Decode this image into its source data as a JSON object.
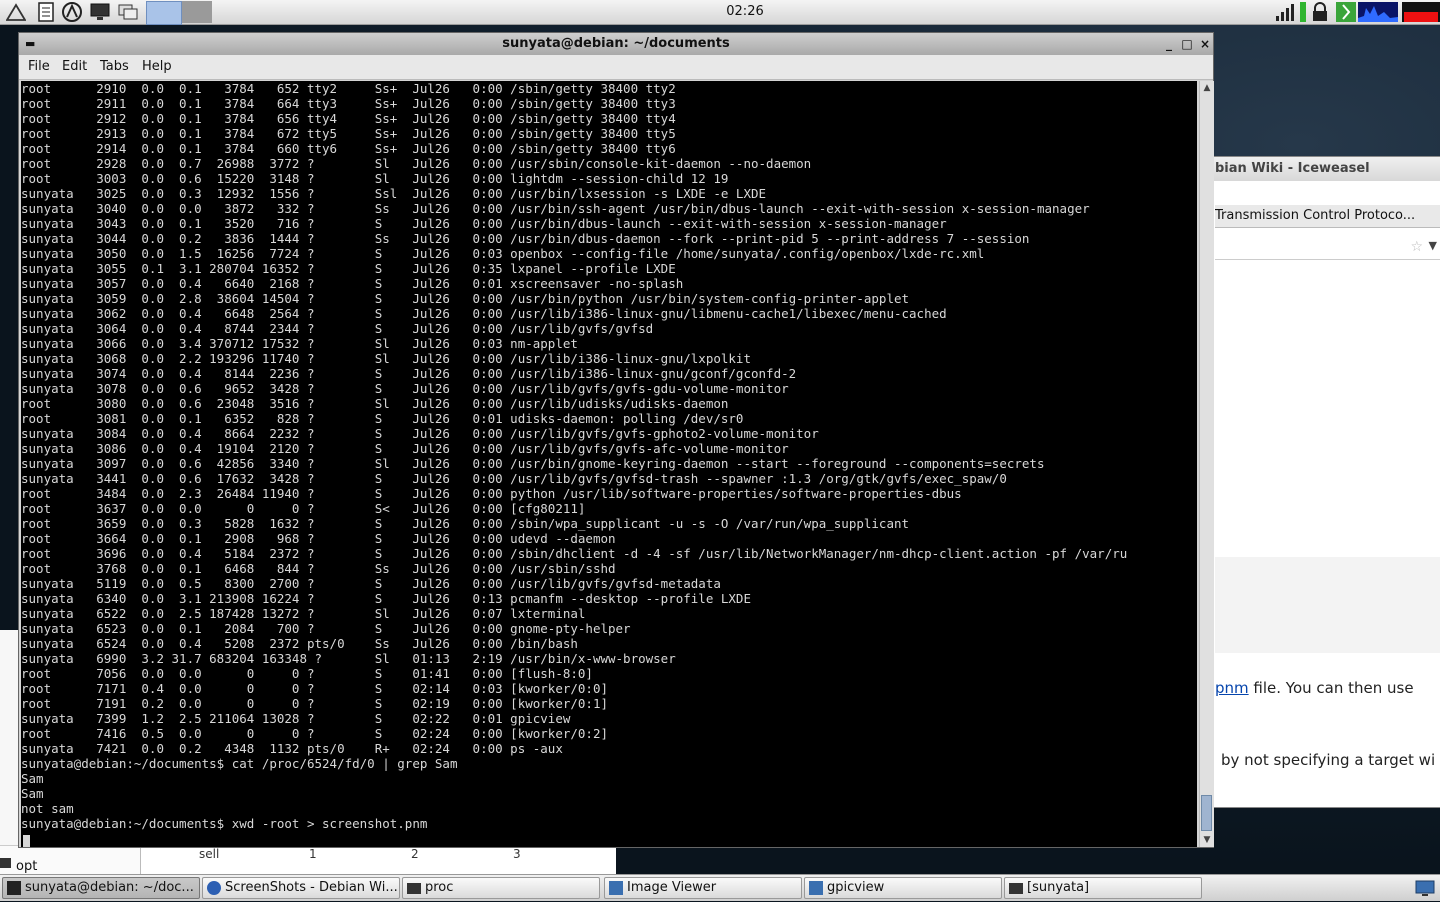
{
  "top_panel": {
    "clock": "02:26",
    "launchers": [
      "menu-icon",
      "notes-icon",
      "browser-icon",
      "monitor-icon",
      "windows-icon"
    ],
    "tray_icons": [
      "network-signal-icon",
      "lock-icon",
      "exit-icon",
      "cpu-graph-icon",
      "battery-icon"
    ]
  },
  "background_windows": {
    "iceweasel_title": "bian Wiki - Iceweasel",
    "iceweasel_tab": "Transmission Control Protoco...",
    "iceweasel_link": "pnm",
    "iceweasel_text_after_link": " file. You can then use",
    "iceweasel_text2": "by not specifying a target wi",
    "filemgr_entry": "opt",
    "sheet_cells": [
      "sell",
      "1",
      "2",
      "3"
    ]
  },
  "terminal": {
    "title": "sunyata@debian: ~/documents",
    "window_buttons": [
      "_",
      "□",
      "×"
    ],
    "menu": [
      "File",
      "Edit",
      "Tabs",
      "Help"
    ],
    "lines": [
      "root      2910  0.0  0.1   3784   652 tty2     Ss+  Jul26   0:00 /sbin/getty 38400 tty2",
      "root      2911  0.0  0.1   3784   664 tty3     Ss+  Jul26   0:00 /sbin/getty 38400 tty3",
      "root      2912  0.0  0.1   3784   656 tty4     Ss+  Jul26   0:00 /sbin/getty 38400 tty4",
      "root      2913  0.0  0.1   3784   672 tty5     Ss+  Jul26   0:00 /sbin/getty 38400 tty5",
      "root      2914  0.0  0.1   3784   660 tty6     Ss+  Jul26   0:00 /sbin/getty 38400 tty6",
      "root      2928  0.0  0.7  26988  3772 ?        Sl   Jul26   0:00 /usr/sbin/console-kit-daemon --no-daemon",
      "root      3003  0.0  0.6  15220  3148 ?        Sl   Jul26   0:00 lightdm --session-child 12 19",
      "sunyata   3025  0.0  0.3  12932  1556 ?        Ssl  Jul26   0:00 /usr/bin/lxsession -s LXDE -e LXDE",
      "sunyata   3040  0.0  0.0   3872   332 ?        Ss   Jul26   0:00 /usr/bin/ssh-agent /usr/bin/dbus-launch --exit-with-session x-session-manager",
      "sunyata   3043  0.0  0.1   3520   716 ?        S    Jul26   0:00 /usr/bin/dbus-launch --exit-with-session x-session-manager",
      "sunyata   3044  0.0  0.2   3836  1444 ?        Ss   Jul26   0:00 /usr/bin/dbus-daemon --fork --print-pid 5 --print-address 7 --session",
      "sunyata   3050  0.0  1.5  16256  7724 ?        S    Jul26   0:03 openbox --config-file /home/sunyata/.config/openbox/lxde-rc.xml",
      "sunyata   3055  0.1  3.1 280704 16352 ?        S    Jul26   0:35 lxpanel --profile LXDE",
      "sunyata   3057  0.0  0.4   6640  2168 ?        S    Jul26   0:01 xscreensaver -no-splash",
      "sunyata   3059  0.0  2.8  38604 14504 ?        S    Jul26   0:00 /usr/bin/python /usr/bin/system-config-printer-applet",
      "sunyata   3062  0.0  0.4   6648  2564 ?        S    Jul26   0:00 /usr/lib/i386-linux-gnu/libmenu-cache1/libexec/menu-cached",
      "sunyata   3064  0.0  0.4   8744  2344 ?        S    Jul26   0:00 /usr/lib/gvfs/gvfsd",
      "sunyata   3066  0.0  3.4 370712 17532 ?        Sl   Jul26   0:03 nm-applet",
      "sunyata   3068  0.0  2.2 193296 11740 ?        Sl   Jul26   0:00 /usr/lib/i386-linux-gnu/lxpolkit",
      "sunyata   3074  0.0  0.4   8144  2236 ?        S    Jul26   0:00 /usr/lib/i386-linux-gnu/gconf/gconfd-2",
      "sunyata   3078  0.0  0.6   9652  3428 ?        S    Jul26   0:00 /usr/lib/gvfs/gvfs-gdu-volume-monitor",
      "root      3080  0.0  0.6  23048  3516 ?        Sl   Jul26   0:00 /usr/lib/udisks/udisks-daemon",
      "root      3081  0.0  0.1   6352   828 ?        S    Jul26   0:01 udisks-daemon: polling /dev/sr0",
      "sunyata   3084  0.0  0.4   8664  2232 ?        S    Jul26   0:00 /usr/lib/gvfs/gvfs-gphoto2-volume-monitor",
      "sunyata   3086  0.0  0.4  19104  2120 ?        S    Jul26   0:00 /usr/lib/gvfs/gvfs-afc-volume-monitor",
      "sunyata   3097  0.0  0.6  42856  3340 ?        Sl   Jul26   0:00 /usr/bin/gnome-keyring-daemon --start --foreground --components=secrets",
      "sunyata   3441  0.0  0.6  17632  3428 ?        S    Jul26   0:00 /usr/lib/gvfs/gvfsd-trash --spawner :1.3 /org/gtk/gvfs/exec_spaw/0",
      "root      3484  0.0  2.3  26484 11940 ?        S    Jul26   0:00 python /usr/lib/software-properties/software-properties-dbus",
      "root      3637  0.0  0.0      0     0 ?        S<   Jul26   0:00 [cfg80211]",
      "root      3659  0.0  0.3   5828  1632 ?        S    Jul26   0:00 /sbin/wpa_supplicant -u -s -O /var/run/wpa_supplicant",
      "root      3664  0.0  0.1   2908   968 ?        S    Jul26   0:00 udevd --daemon",
      "root      3696  0.0  0.4   5184  2372 ?        S    Jul26   0:00 /sbin/dhclient -d -4 -sf /usr/lib/NetworkManager/nm-dhcp-client.action -pf /var/ru",
      "root      3768  0.0  0.1   6468   844 ?        Ss   Jul26   0:00 /usr/sbin/sshd",
      "sunyata   5119  0.0  0.5   8300  2700 ?        S    Jul26   0:00 /usr/lib/gvfs/gvfsd-metadata",
      "sunyata   6340  0.0  3.1 213908 16224 ?        S    Jul26   0:13 pcmanfm --desktop --profile LXDE",
      "sunyata   6522  0.0  2.5 187428 13272 ?        Sl   Jul26   0:07 lxterminal",
      "sunyata   6523  0.0  0.1   2084   700 ?        S    Jul26   0:00 gnome-pty-helper",
      "sunyata   6524  0.0  0.4   5208  2372 pts/0    Ss   Jul26   0:00 /bin/bash",
      "sunyata   6990  3.2 31.7 683204 163348 ?       Sl   01:13   2:19 /usr/bin/x-www-browser",
      "root      7056  0.0  0.0      0     0 ?        S    01:41   0:00 [flush-8:0]",
      "root      7171  0.4  0.0      0     0 ?        S    02:14   0:03 [kworker/0:0]",
      "root      7191  0.2  0.0      0     0 ?        S    02:19   0:00 [kworker/0:1]",
      "sunyata   7399  1.2  2.5 211064 13028 ?        S    02:22   0:01 gpicview",
      "root      7416  0.5  0.0      0     0 ?        S    02:24   0:00 [kworker/0:2]",
      "sunyata   7421  0.0  0.2   4348  1132 pts/0    R+   02:24   0:00 ps -aux",
      "sunyata@debian:~/documents$ cat /proc/6524/fd/0 | grep Sam",
      "Sam",
      "Sam",
      "not sam",
      "sunyata@debian:~/documents$ xwd -root > screenshot.pnm"
    ]
  },
  "taskbar": {
    "tasks": [
      {
        "label": "sunyata@debian: ~/doc...",
        "icon": "terminal-icon"
      },
      {
        "label": "ScreenShots - Debian Wi...",
        "icon": "browser-icon"
      },
      {
        "label": "proc",
        "icon": "folder-icon"
      },
      {
        "label": "Image Viewer",
        "icon": "image-viewer-icon"
      },
      {
        "label": "gpicview",
        "icon": "image-viewer-icon"
      },
      {
        "label": "[sunyata]",
        "icon": "folder-icon"
      }
    ],
    "tray": "desktop-icon"
  }
}
